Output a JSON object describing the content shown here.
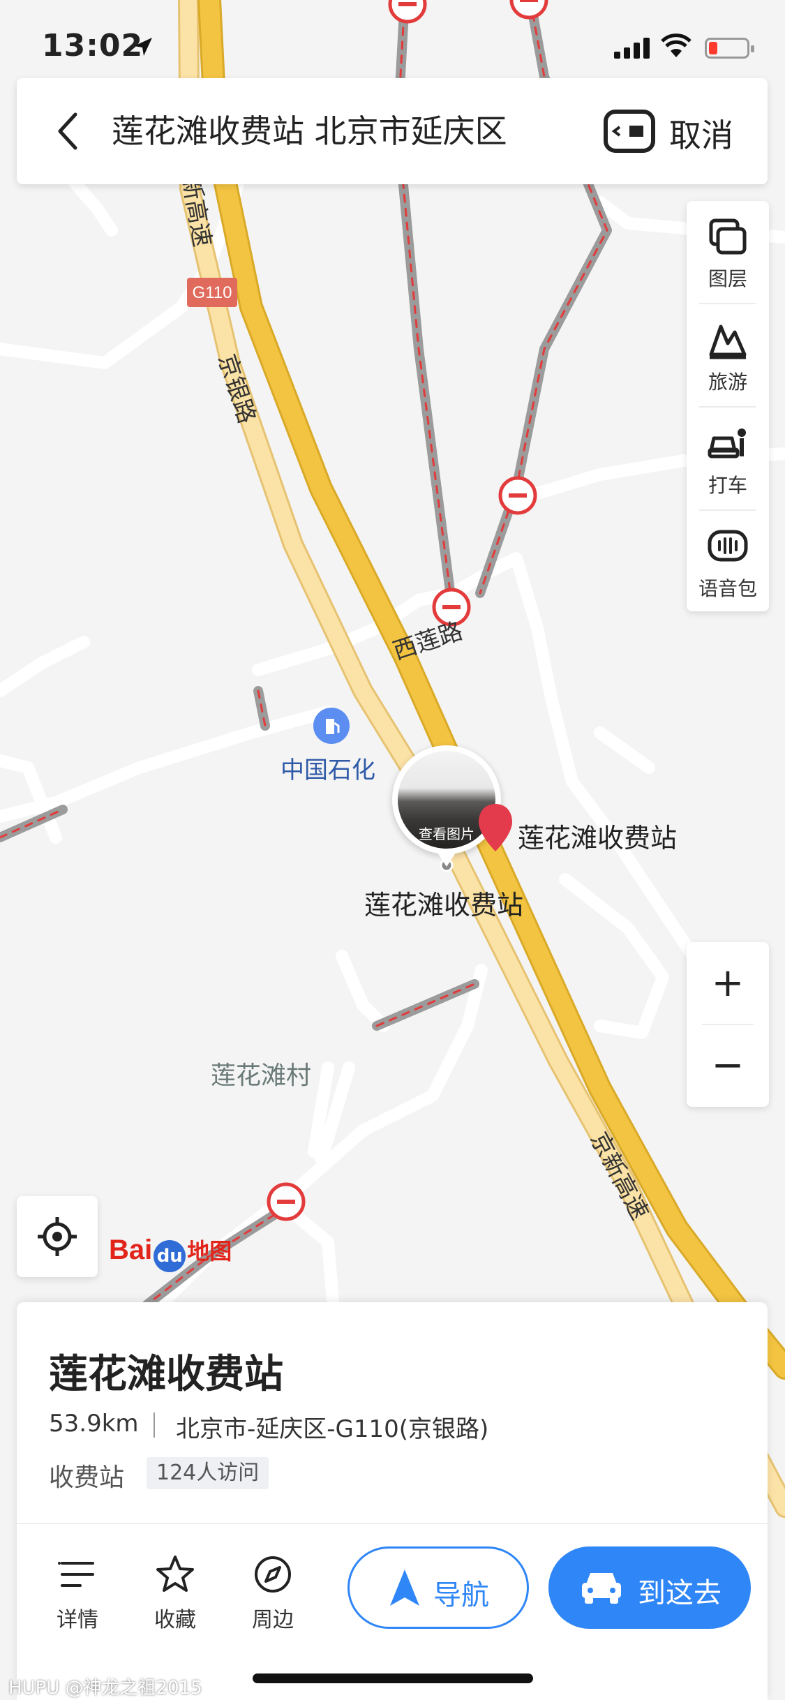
{
  "status_bar": {
    "time": "13:02"
  },
  "search_bar": {
    "query": "莲花滩收费站 北京市延庆区",
    "cancel_label": "取消"
  },
  "tools": [
    {
      "label": "图层",
      "icon": "layers-icon"
    },
    {
      "label": "旅游",
      "icon": "travel-icon"
    },
    {
      "label": "打车",
      "icon": "taxi-icon"
    },
    {
      "label": "语音包",
      "icon": "voice-pack-icon"
    }
  ],
  "zoom": {
    "in_label": "+",
    "out_label": "−"
  },
  "map": {
    "road_labels": {
      "g110_shield": "G110",
      "jingyin_top": "京银路",
      "jingxin_top": "新高速",
      "xilian": "西莲路",
      "jingxin_bottom": "京新高速"
    },
    "gas_station_label": "中国石化",
    "photo_caption": "查看图片",
    "pin_label": "莲花滩收费站",
    "toll_label": "莲花滩收费站",
    "village_label": "莲花滩村",
    "brand_main": "Bai",
    "brand_du": "du",
    "brand_map": "地图",
    "colors": {
      "highway": "#f3c441",
      "trunk": "#fbe2a6",
      "restricted_road": "#9b9b9b",
      "restricted_marker": "#e33b3b",
      "accent": "#2f86f6"
    }
  },
  "place_card": {
    "name": "莲花滩收费站",
    "distance": "53.9km",
    "address": "北京市-延庆区-G110(京银路)",
    "category": "收费站",
    "visits": "124人访问",
    "actions": [
      {
        "label": "详情",
        "icon": "list-icon"
      },
      {
        "label": "收藏",
        "icon": "star-icon"
      },
      {
        "label": "周边",
        "icon": "compass-icon"
      }
    ],
    "navigate_label": "导航",
    "go_label": "到这去"
  },
  "watermark": "HUPU @神龙之祖2015"
}
